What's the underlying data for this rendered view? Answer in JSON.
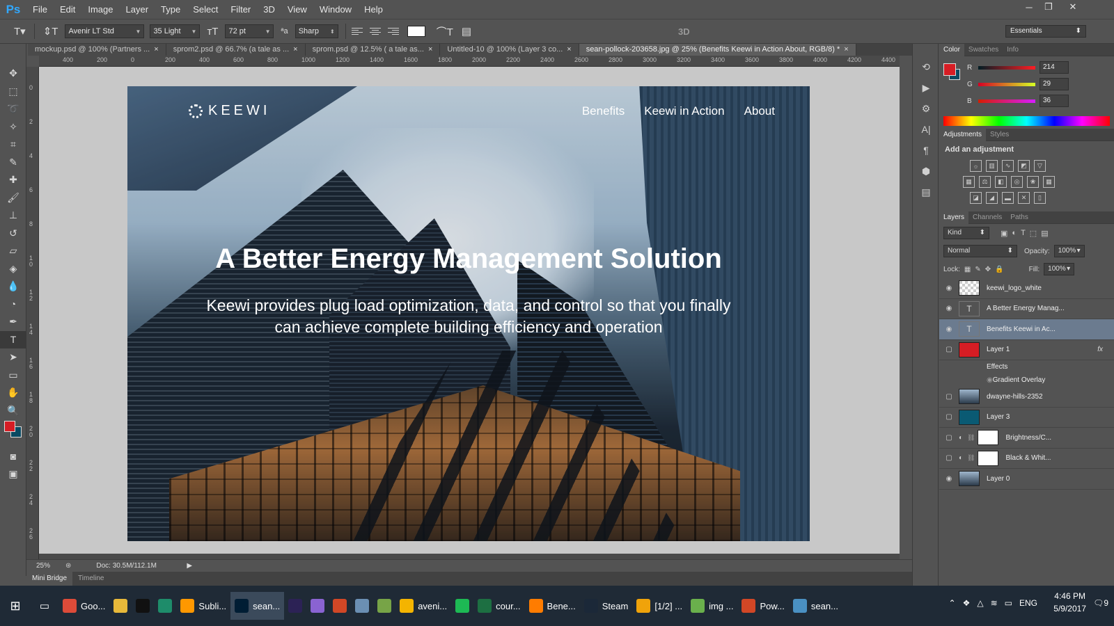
{
  "app": {
    "logo": "Ps"
  },
  "menu": [
    "File",
    "Edit",
    "Image",
    "Layer",
    "Type",
    "Select",
    "Filter",
    "3D",
    "View",
    "Window",
    "Help"
  ],
  "window_controls": [
    "─",
    "❐",
    "✕"
  ],
  "options": {
    "font_family": "Avenir LT Std",
    "font_style": "35 Light",
    "font_size": "72 pt",
    "antialias": "Sharp",
    "text_color": "#ffffff",
    "threed_label": "3D"
  },
  "workspace_select": "Essentials",
  "tabs": [
    {
      "label": "mockup.psd @ 100% (Partners ...",
      "active": false
    },
    {
      "label": "sprom2.psd @ 66.7% (a tale as ...",
      "active": false
    },
    {
      "label": "sprom.psd @ 12.5% ( a tale  as...",
      "active": false
    },
    {
      "label": "Untitled-10 @ 100% (Layer 3 co...",
      "active": false
    },
    {
      "label": "sean-pollock-203658.jpg @ 25% (Benefits      Keewi in Action      About, RGB/8) *",
      "active": true
    }
  ],
  "ruler_top": [
    "400",
    "200",
    "0",
    "200",
    "400",
    "600",
    "800",
    "1000",
    "1200",
    "1400",
    "1600",
    "1800",
    "2000",
    "2200",
    "2400",
    "2600",
    "2800",
    "3000",
    "3200",
    "3400",
    "3600",
    "3800",
    "4000",
    "4200",
    "4400"
  ],
  "ruler_left": [
    "0",
    "2",
    "4",
    "6",
    "8",
    "1 0",
    "1 2",
    "1 4",
    "1 6",
    "1 8",
    "2 0",
    "2 2",
    "2 4",
    "2 6"
  ],
  "canvas": {
    "brand": "KEEWI",
    "nav": [
      "Benefits",
      "Keewi in Action",
      "About"
    ],
    "title": "A Better Energy Management Solution",
    "subtitle": "Keewi provides plug load optimization, data, and control so that you finally can achieve complete building efficiency and operation"
  },
  "status": {
    "zoom": "25%",
    "doc": "Doc: 30.5M/112.1M"
  },
  "bottom_tabs": [
    "Mini Bridge",
    "Timeline"
  ],
  "color_panel": {
    "tabs": [
      "Color",
      "Swatches",
      "Info"
    ],
    "foreground": "#d61d24",
    "background": "#0a4a62",
    "channels": [
      {
        "label": "R",
        "value": "214"
      },
      {
        "label": "G",
        "value": "29"
      },
      {
        "label": "B",
        "value": "36"
      }
    ]
  },
  "adjustments": {
    "tabs": [
      "Adjustments",
      "Styles"
    ],
    "title": "Add an adjustment"
  },
  "layers_panel": {
    "tabs": [
      "Layers",
      "Channels",
      "Paths"
    ],
    "kind": "Kind",
    "blend": "Normal",
    "opacity_label": "Opacity:",
    "opacity": "100%",
    "lock_label": "Lock:",
    "fill_label": "Fill:",
    "fill": "100%",
    "layers": [
      {
        "name": "keewi_logo_white",
        "visible": true,
        "type": "image"
      },
      {
        "name": "A Better Energy Manag...",
        "visible": true,
        "type": "text"
      },
      {
        "name": "Benefits      Keewi in Ac...",
        "visible": true,
        "type": "text",
        "selected": true
      },
      {
        "name": "Layer 1",
        "visible": false,
        "type": "fill",
        "fx": "fx"
      },
      {
        "name": "dwayne-hills-2352",
        "visible": false,
        "type": "photo"
      },
      {
        "name": "Layer 3",
        "visible": false,
        "type": "teal"
      },
      {
        "name": "Brightness/C...",
        "visible": false,
        "type": "adjust"
      },
      {
        "name": "Black & Whit...",
        "visible": false,
        "type": "adjust"
      },
      {
        "name": "Layer 0",
        "visible": true,
        "type": "photo"
      }
    ],
    "effects_label": "Effects",
    "effect_item": "Gradient Overlay"
  },
  "taskbar": {
    "items": [
      {
        "label": "Goo...",
        "icon": "chrome-icon",
        "color": "#dd4b39"
      },
      {
        "label": "",
        "icon": "folder-icon",
        "color": "#e8b93a"
      },
      {
        "label": "",
        "icon": "terminal-icon",
        "color": "#111111"
      },
      {
        "label": "",
        "icon": "gitkraken-icon",
        "color": "#1e8c6a"
      },
      {
        "label": "Subli...",
        "icon": "sublime-icon",
        "color": "#ff9800"
      },
      {
        "label": "sean...",
        "icon": "photoshop-icon",
        "color": "#001d34",
        "active": true
      },
      {
        "label": "",
        "icon": "eclipse-icon",
        "color": "#2c2255"
      },
      {
        "label": "",
        "icon": "app-icon",
        "color": "#8a63d2"
      },
      {
        "label": "",
        "icon": "office-icon",
        "color": "#d24726"
      },
      {
        "label": "",
        "icon": "mail-icon",
        "color": "#6b8fb3"
      },
      {
        "label": "",
        "icon": "notepad-icon",
        "color": "#77a447"
      },
      {
        "label": "aveni...",
        "icon": "search-app-icon",
        "color": "#f4b400"
      },
      {
        "label": "",
        "icon": "spotify-icon",
        "color": "#1db954"
      },
      {
        "label": "cour...",
        "icon": "excel-icon",
        "color": "#1d6f42"
      },
      {
        "label": "Bene...",
        "icon": "illustrator-icon",
        "color": "#ff7c00"
      },
      {
        "label": "Steam",
        "icon": "steam-icon",
        "color": "#1b2838"
      },
      {
        "label": "[1/2] ...",
        "icon": "lambda-icon",
        "color": "#f0a30a"
      },
      {
        "label": "img ...",
        "icon": "clover-icon",
        "color": "#6ab04c"
      },
      {
        "label": "Pow...",
        "icon": "powerpoint-icon",
        "color": "#d24726"
      },
      {
        "label": "sean...",
        "icon": "photos-icon",
        "color": "#4a90c2"
      }
    ],
    "lang": "ENG",
    "time": "4:46 PM",
    "date": "5/9/2017",
    "notif_count": "9"
  }
}
